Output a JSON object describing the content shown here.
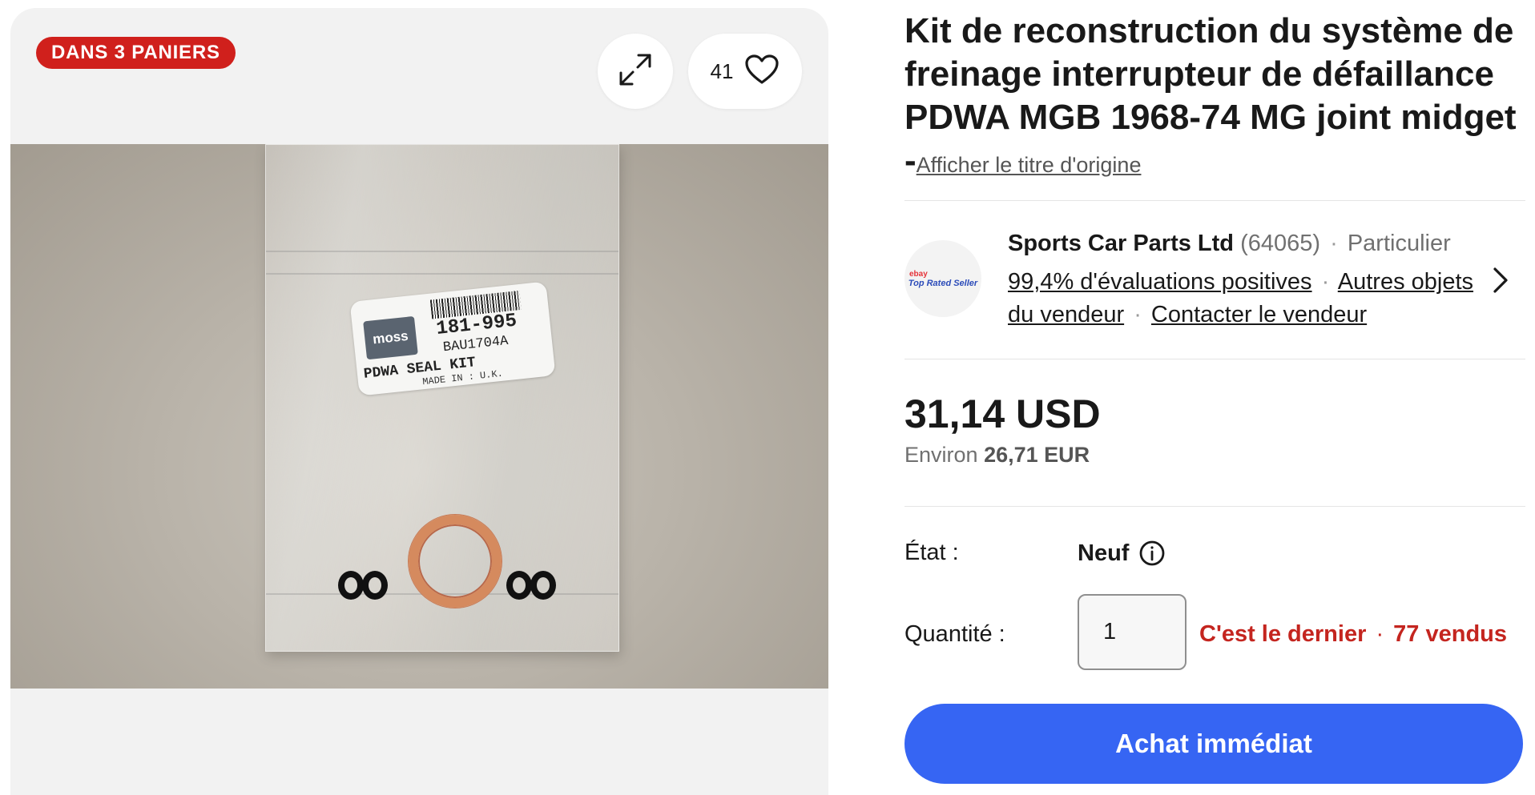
{
  "gallery": {
    "badge": "DANS 3 PANIERS",
    "watch_count": "41",
    "image_label": {
      "brand": "moss",
      "part_number": "181-995",
      "ref": "BAU1704A",
      "kit_name": "PDWA SEAL KIT",
      "made_in": "MADE IN : U.K."
    }
  },
  "listing": {
    "title": "Kit de reconstruction du système de freinage interrupteur de défaillance PDWA MGB 1968-74 MG joint midget -",
    "original_title_link": "Afficher le titre d'origine"
  },
  "seller": {
    "badge_brand": "ebay",
    "badge_text": "Top Rated Seller",
    "name": "Sports Car Parts Ltd",
    "feedback_count": "(64065)",
    "separator": "·",
    "type": "Particulier",
    "positive_feedback": "99,4% d'évaluations positives",
    "other_items": "Autres objets du vendeur",
    "contact": "Contacter le vendeur"
  },
  "price": {
    "main": "31,14 USD",
    "approx_label": "Environ",
    "approx_value": "26,71 EUR"
  },
  "condition": {
    "label": "État :",
    "value": "Neuf"
  },
  "quantity": {
    "label": "Quantité :",
    "value": "1",
    "last_one": "C'est le dernier",
    "sold": "77 vendus"
  },
  "buy_button": "Achat immédiat",
  "colors": {
    "badge_red": "#d0201c",
    "buy_blue": "#3665f3",
    "stock_red": "#c4251f"
  },
  "icons": [
    "expand-icon",
    "heart-icon",
    "chevron-right-icon",
    "info-icon"
  ]
}
